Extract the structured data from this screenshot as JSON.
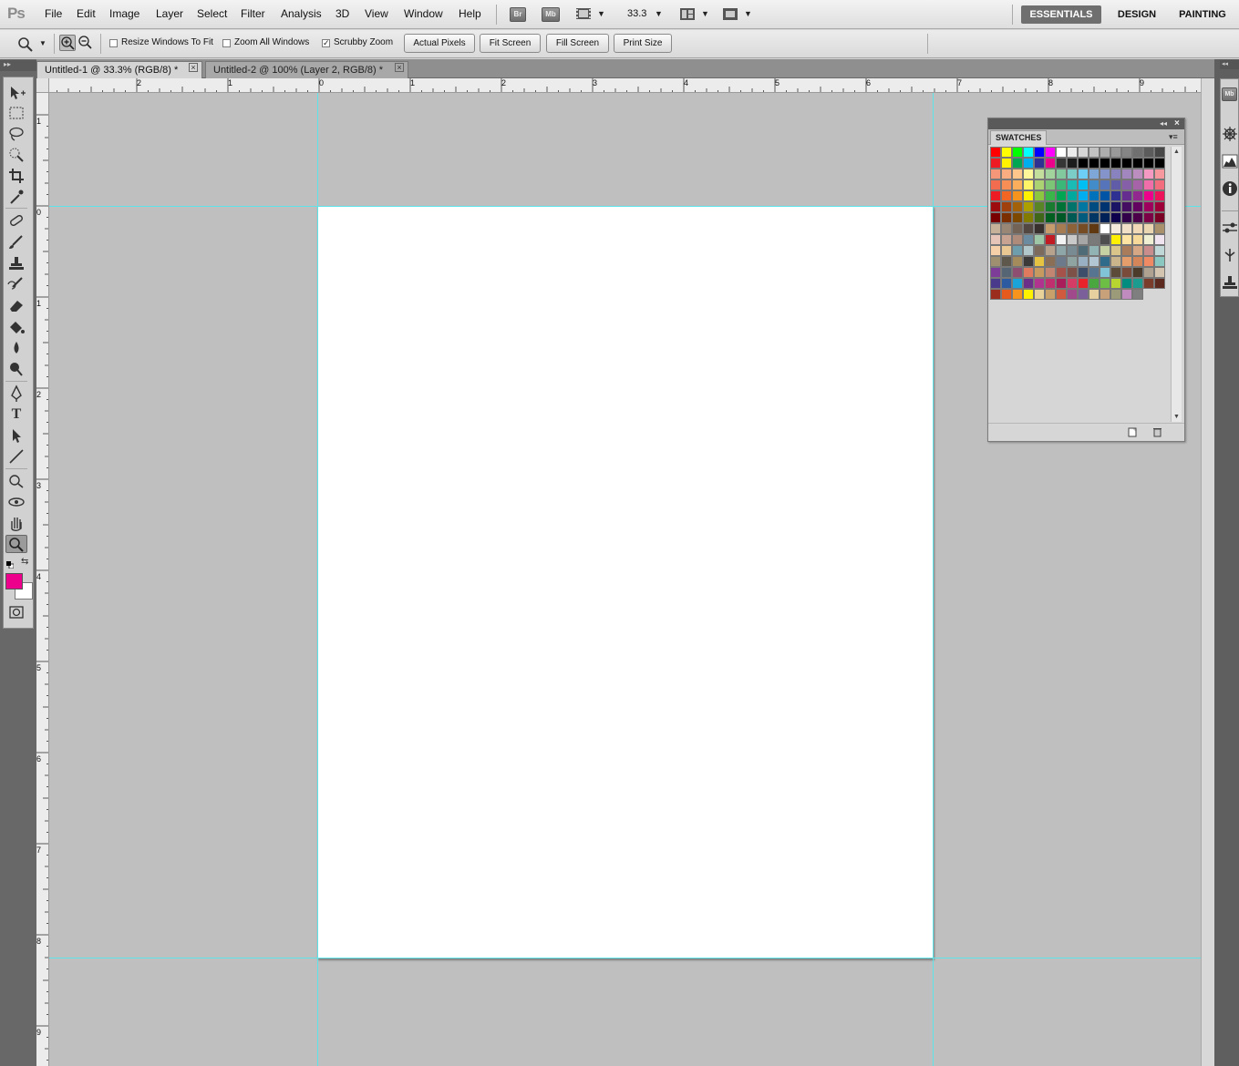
{
  "app": {
    "logo": "Ps",
    "menus": [
      "File",
      "Edit",
      "Image",
      "Layer",
      "Select",
      "Filter",
      "Analysis",
      "3D",
      "View",
      "Window",
      "Help"
    ],
    "bridge_label": "Br",
    "minibridge_label": "Mb",
    "zoom_level": "33.3",
    "workspaces": [
      "ESSENTIALS",
      "DESIGN",
      "PAINTING"
    ],
    "active_workspace": "ESSENTIALS"
  },
  "options": {
    "resize_windows": {
      "label": "Resize Windows To Fit",
      "checked": false
    },
    "zoom_all": {
      "label": "Zoom All Windows",
      "checked": false
    },
    "scrubby_zoom": {
      "label": "Scrubby Zoom",
      "checked": true
    },
    "actual_pixels": "Actual Pixels",
    "fit_screen": "Fit Screen",
    "fill_screen": "Fill Screen",
    "print_size": "Print Size"
  },
  "documents": [
    {
      "title": "Untitled-1 @ 33.3% (RGB/8) *",
      "active": true
    },
    {
      "title": "Untitled-2 @ 100% (Layer 2, RGB/8) *",
      "active": false
    }
  ],
  "rulers": {
    "top_labels": [
      "2",
      "1",
      "0",
      "1",
      "2",
      "3",
      "4",
      "5",
      "6",
      "7",
      "8",
      "9"
    ],
    "left_labels": [
      "1",
      "0",
      "1",
      "2",
      "3",
      "4",
      "5",
      "6",
      "7",
      "8",
      "9"
    ]
  },
  "colors": {
    "foreground": "#ec008c",
    "background": "#ffffff",
    "guide": "#5ee4e8"
  },
  "swatches": {
    "title": "SWATCHES",
    "colors": [
      "#ff0000",
      "#ffff00",
      "#00ff00",
      "#00ffff",
      "#0000ff",
      "#ff00ff",
      "#ffffff",
      "#ebebeb",
      "#d6d6d6",
      "#c2c2c2",
      "#adadad",
      "#999999",
      "#858585",
      "#707070",
      "#5c5c5c",
      "#474747",
      "#ed1c24",
      "#fff200",
      "#00a651",
      "#00aeef",
      "#2e3192",
      "#ec008c",
      "#363636",
      "#1c1c1c",
      "#000000",
      "#000000",
      "#000000",
      "#000000",
      "#000000",
      "#000000",
      "#000000",
      "#000000",
      "#f7977a",
      "#f9ad81",
      "#fdc68a",
      "#fff79a",
      "#c4df9b",
      "#a3d39c",
      "#82ca9d",
      "#7bcdc8",
      "#6ecff6",
      "#7ea7d8",
      "#8493ca",
      "#8882be",
      "#a187be",
      "#bc8dbf",
      "#f49ac2",
      "#f6989d",
      "#f26c4f",
      "#f68e55",
      "#fbaf5c",
      "#fff467",
      "#acd372",
      "#7cc576",
      "#3bb878",
      "#1abbb4",
      "#00bff3",
      "#438cca",
      "#5574b9",
      "#605ca8",
      "#855fa8",
      "#a763a8",
      "#f06ea9",
      "#f26d7d",
      "#ed1c24",
      "#f26522",
      "#f7941d",
      "#fff200",
      "#8dc73f",
      "#39b54a",
      "#00a651",
      "#00a99d",
      "#00aeef",
      "#0072bc",
      "#0054a6",
      "#2e3192",
      "#662d91",
      "#92278f",
      "#ec008c",
      "#ed145b",
      "#9e0b0f",
      "#a0410d",
      "#a36209",
      "#aba000",
      "#598527",
      "#197b30",
      "#007236",
      "#00746b",
      "#0076a3",
      "#004b80",
      "#003471",
      "#1b1464",
      "#440e62",
      "#630460",
      "#9e005d",
      "#9e0039",
      "#790000",
      "#7b2e00",
      "#7d4900",
      "#827b00",
      "#406618",
      "#005e20",
      "#005826",
      "#005952",
      "#005b7f",
      "#003663",
      "#002157",
      "#0d004c",
      "#32004b",
      "#4b0049",
      "#7b0046",
      "#7a0026",
      "#c7b299",
      "#998675",
      "#736357",
      "#534741",
      "#37302d",
      "#c69c6d",
      "#a67c52",
      "#8c6239",
      "#754c24",
      "#603913",
      "#ffffff",
      "#f5ebdc",
      "#f2dfc7",
      "#f1d8b6",
      "#ead7b2",
      "#a8916b",
      "#e6c4b8",
      "#c9a392",
      "#ae8b7b",
      "#6a8ba0",
      "#9ec7a8",
      "#c11b24",
      "#f3f3f3",
      "#c9c9c9",
      "#a6a6a6",
      "#7a7a7a",
      "#4e4e4e",
      "#ffef00",
      "#fde4a3",
      "#f7d99a",
      "#efefd4",
      "#f0e4f0",
      "#f5d0a9",
      "#e9c894",
      "#6e9eab",
      "#b1c7c9",
      "#7c6b5c",
      "#b6a28d",
      "#8fa6a9",
      "#7a8c93",
      "#4f6b77",
      "#92b3b4",
      "#c6d1a3",
      "#d9c48a",
      "#a97d5b",
      "#d5a784",
      "#ca8d8d",
      "#bfd7d7",
      "#9e8f71",
      "#5e574b",
      "#a48b5b",
      "#3c3a38",
      "#e6c341",
      "#8a6f56",
      "#6c7a8c",
      "#8fa3a0",
      "#99b0c2",
      "#b2c5d3",
      "#2f6b8a",
      "#c9b48c",
      "#e59d6c",
      "#d5855a",
      "#ef8a65",
      "#8ac7c1",
      "#7d3c98",
      "#566573",
      "#8e4e72",
      "#e07a5f",
      "#c79a5f",
      "#c28572",
      "#a5524a",
      "#7e5148",
      "#3d4e6b",
      "#577590",
      "#81c3d7",
      "#5d4b3a",
      "#7a4a3a",
      "#4c3b2a",
      "#b0a290",
      "#d4c5b0",
      "#4a3a8c",
      "#2c5aa0",
      "#19a3d9",
      "#6b2f8a",
      "#b0338f",
      "#c0306f",
      "#a91e5a",
      "#d43c66",
      "#e8232a",
      "#4aa63e",
      "#6cbe45",
      "#b8d430",
      "#008c7e",
      "#1c9c8f",
      "#7a3d2c",
      "#5c2a1e",
      "#9b2d1f",
      "#e65a1e",
      "#f7941d",
      "#fff200",
      "#e8d29a",
      "#c8a06a",
      "#d05a3e",
      "#a04a8c",
      "#7b5f9a",
      "#e6d0a0",
      "#c8a07a",
      "#9b9b7a",
      "#c08cc0",
      "#7f7f7f"
    ]
  }
}
